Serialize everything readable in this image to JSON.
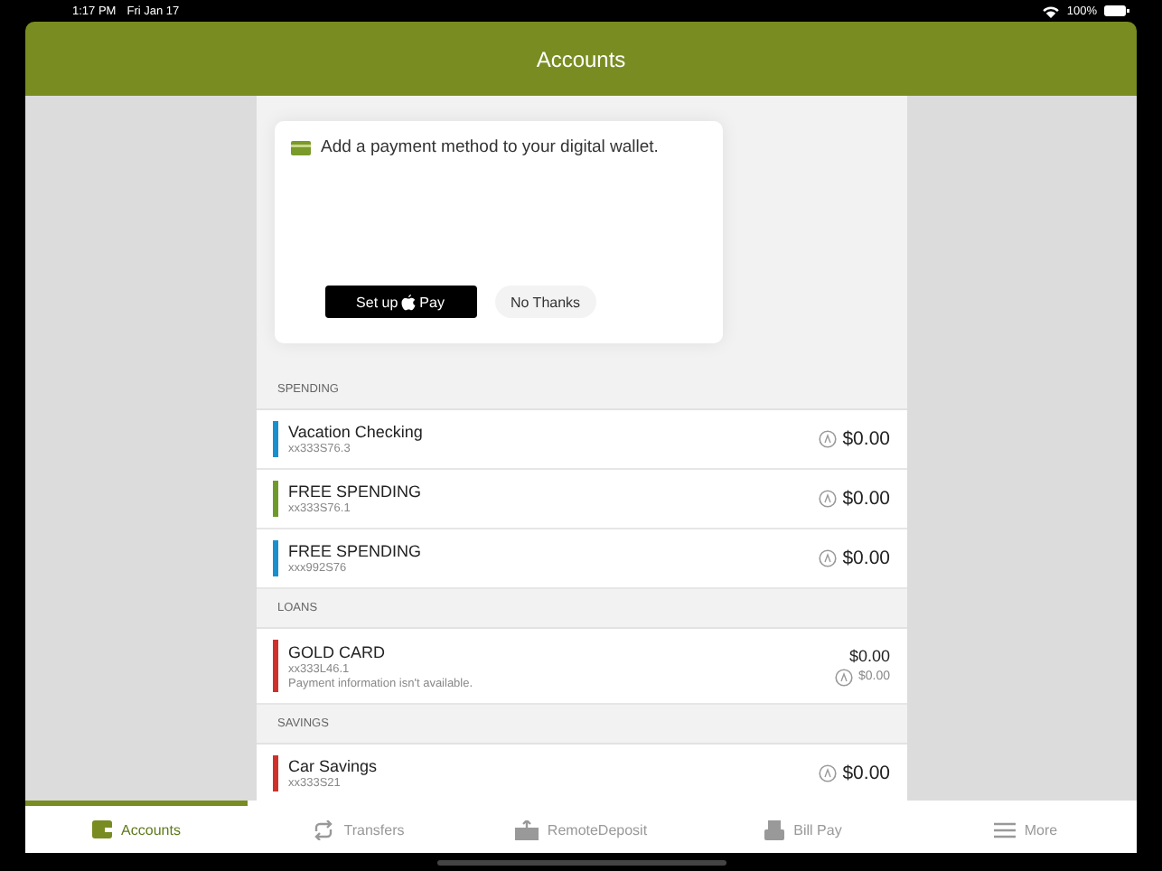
{
  "status_bar": {
    "time": "1:17 PM",
    "date": "Fri Jan 17",
    "battery": "100%"
  },
  "header": {
    "title": "Accounts"
  },
  "wallet_card": {
    "message": "Add a payment method to your digital wallet.",
    "setup_button": {
      "before": "Set up",
      "after": "Pay"
    },
    "dismiss_button": "No Thanks"
  },
  "sections": [
    {
      "title": "SPENDING",
      "accounts": [
        {
          "kind": "deposit",
          "name": "Vacation Checking",
          "number": "xx333S76.3",
          "balance": "$0.00",
          "color": "#1a8fd0"
        },
        {
          "kind": "deposit",
          "name": "FREE SPENDING",
          "number": "xx333S76.1",
          "balance": "$0.00",
          "color": "#6f9a2a"
        },
        {
          "kind": "deposit",
          "name": "FREE SPENDING",
          "number": "xxx992S76",
          "balance": "$0.00",
          "color": "#1a8fd0"
        }
      ]
    },
    {
      "title": "LOANS",
      "accounts": [
        {
          "kind": "loan",
          "name": "GOLD CARD",
          "number": "xx333L46.1",
          "note": "Payment information isn't available.",
          "balance": "$0.00",
          "available": "$0.00",
          "color": "#d0302a"
        }
      ]
    },
    {
      "title": "SAVINGS",
      "accounts": [
        {
          "kind": "deposit",
          "name": "Car Savings",
          "number": "xx333S21",
          "balance": "$0.00",
          "color": "#d0302a"
        }
      ]
    }
  ],
  "tabs": [
    {
      "label": "Accounts",
      "kind": "wallet",
      "selected": true
    },
    {
      "label": "Transfers",
      "kind": "transfer",
      "selected": false
    },
    {
      "label": "RemoteDeposit",
      "kind": "deposit",
      "selected": false
    },
    {
      "label": "Bill Pay",
      "kind": "bill",
      "selected": false
    },
    {
      "label": "More",
      "kind": "menu",
      "selected": false
    }
  ]
}
